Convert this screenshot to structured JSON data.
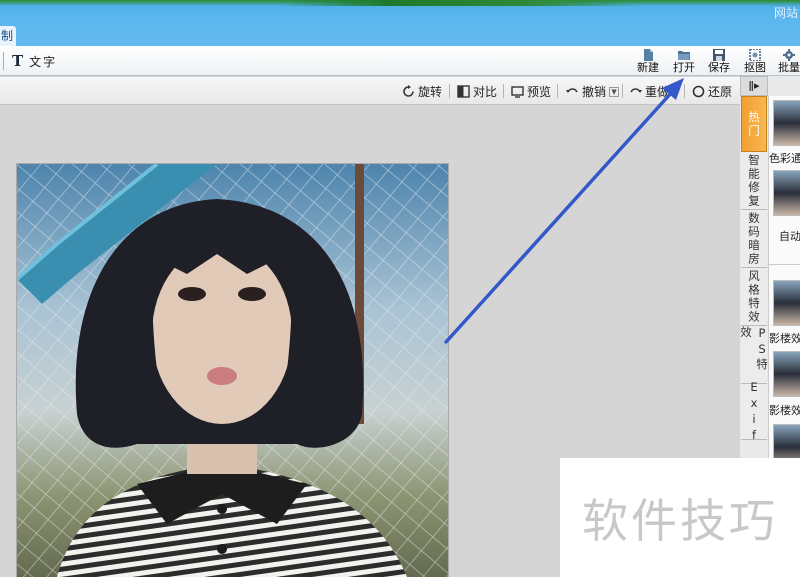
{
  "window": {
    "site_label": "网站",
    "tab_label": "制作"
  },
  "toolbar": {
    "text_tool_icon": "T",
    "text_tool_label": "文字",
    "buttons": [
      {
        "label": "新建",
        "icon": "new-file-icon"
      },
      {
        "label": "打开",
        "icon": "open-folder-icon"
      },
      {
        "label": "保存",
        "icon": "save-disk-icon"
      },
      {
        "label": "抠图",
        "icon": "cutout-icon"
      },
      {
        "label": "批量",
        "icon": "batch-gear-icon"
      }
    ]
  },
  "editbar": {
    "rotate": "旋转",
    "compare": "对比",
    "preview": "预览",
    "undo": "撤销",
    "redo": "重做",
    "restore": "还原"
  },
  "right_panel": {
    "collapse_icon": "ǁ▸",
    "tabs": [
      "热门",
      "智能修复",
      "数码暗房",
      "风格特效",
      "PS特效",
      "Exif"
    ],
    "thumb_labels": [
      "色彩通",
      "自动",
      "影楼效",
      "影楼效"
    ]
  },
  "watermark": {
    "text": "软件技巧"
  },
  "colors": {
    "titlebar": "#5cb7ee",
    "active_tab": "#f0a030",
    "arrow": "#3358c9"
  }
}
